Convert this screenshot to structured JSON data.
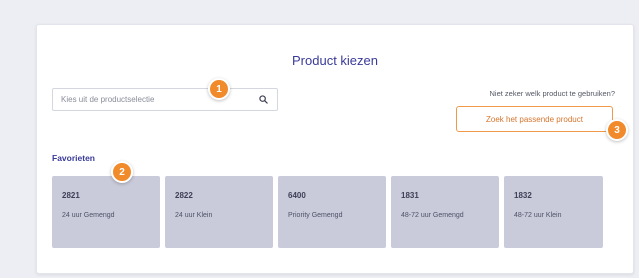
{
  "page": {
    "title": "Product kiezen"
  },
  "search": {
    "placeholder": "Kies uit de productselectie",
    "icon": "search-icon"
  },
  "help": {
    "text": "Niet zeker welk product te gebruiken?",
    "button_label": "Zoek het passende product"
  },
  "favorites": {
    "label": "Favorieten",
    "items": [
      {
        "code": "2821",
        "name": "24 uur Gemengd"
      },
      {
        "code": "2822",
        "name": "24 uur Klein"
      },
      {
        "code": "6400",
        "name": "Priority Gemengd"
      },
      {
        "code": "1831",
        "name": "48-72 uur Gemengd"
      },
      {
        "code": "1832",
        "name": "48-72 uur Klein"
      }
    ]
  },
  "badges": [
    "1",
    "2",
    "3"
  ],
  "colors": {
    "accent": "#3a3a9a",
    "orange": "#f08a2a",
    "tile": "#c9cbda"
  }
}
